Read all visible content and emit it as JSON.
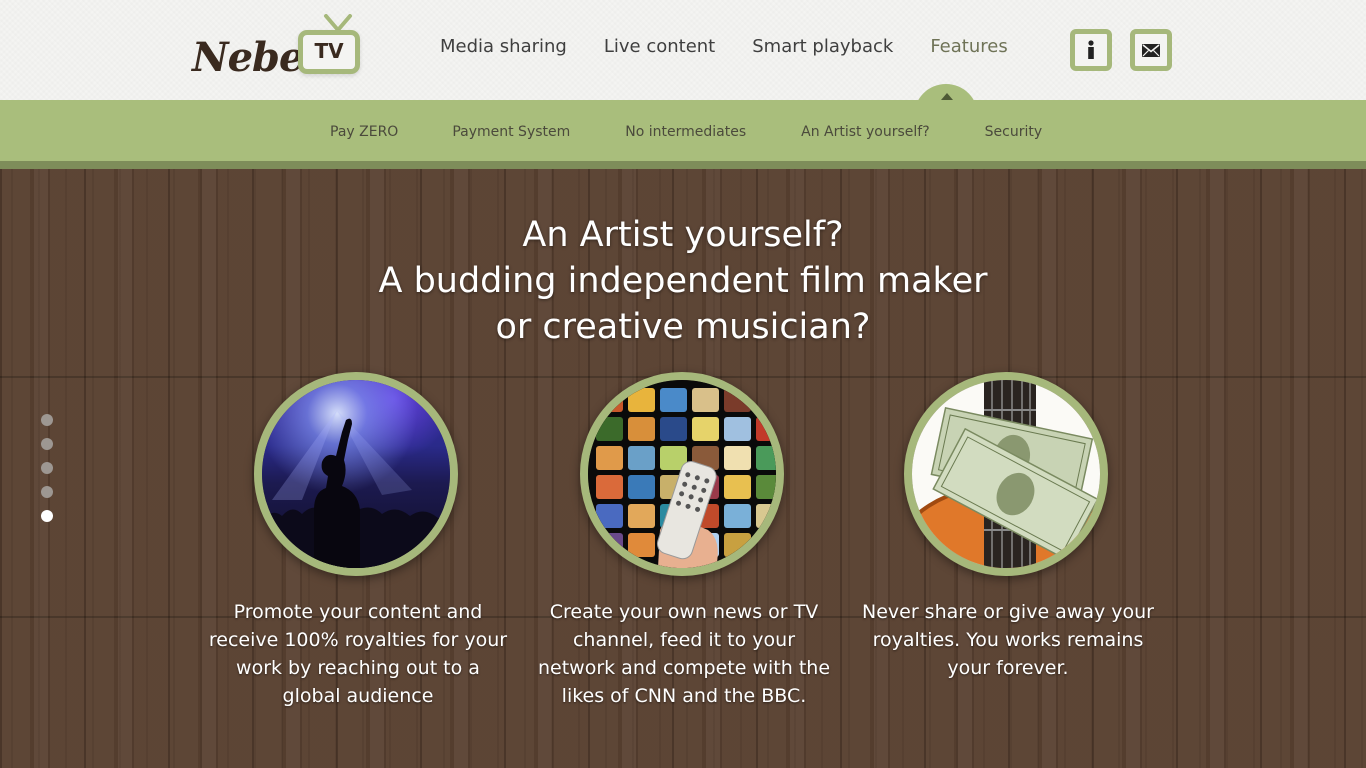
{
  "brand": {
    "name": "Nebel.",
    "tv_label": "TV",
    "accent_color": "#a6b87b",
    "wood_color": "#5a4232"
  },
  "nav": {
    "items": [
      "Media sharing",
      "Live content",
      "Smart playback",
      "Features"
    ],
    "active": "Features"
  },
  "header_icons": {
    "info": "info-icon",
    "mail": "mail-icon"
  },
  "subnav": {
    "items": [
      "Pay ZERO",
      "Payment System",
      "No intermediates",
      "An Artist yourself?",
      "Security"
    ],
    "active": "An Artist yourself?"
  },
  "headline": {
    "lines": [
      "An Artist yourself?",
      "A budding independent film maker",
      "or creative musician?"
    ]
  },
  "slider": {
    "count": 5,
    "active_index": 5
  },
  "features": [
    {
      "image": "concert-crowd-image",
      "lines": [
        "Promote your content and",
        "receive 100% royalties for your",
        "work by reaching out to a",
        "global audience"
      ]
    },
    {
      "image": "tv-wall-remote-image",
      "lines": [
        "Create your own news or TV",
        "channel, feed it to your",
        "network and compete with the",
        "likes of CNN and the BBC."
      ]
    },
    {
      "image": "guitar-money-image",
      "lines": [
        "Never share or give away your",
        "royalties. You works remains",
        "your forever."
      ]
    }
  ]
}
